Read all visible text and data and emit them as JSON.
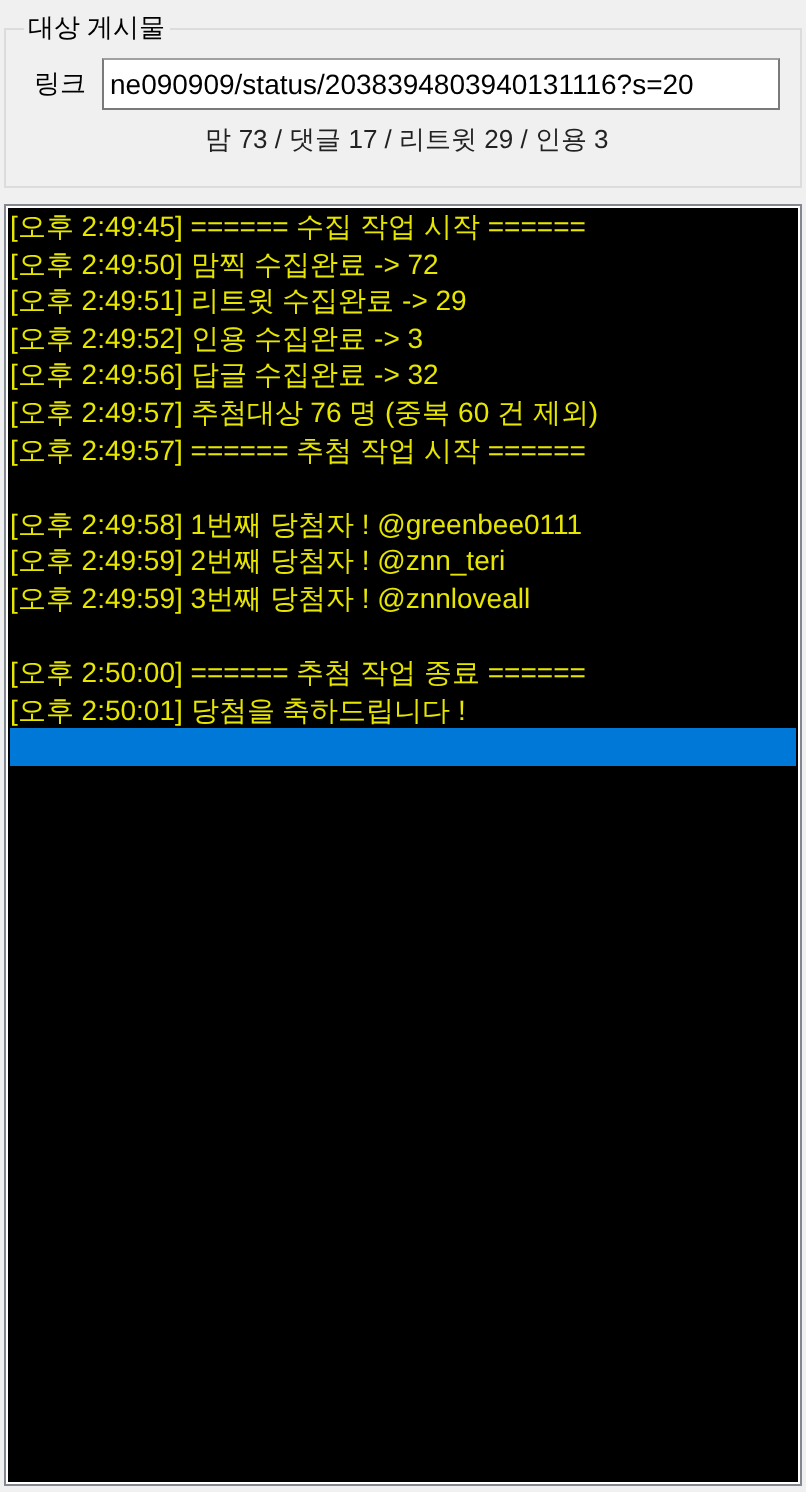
{
  "target_post": {
    "title": "대상 게시물",
    "link_label": "링크",
    "link_value": "ne090909/status/2038394803940131116?s=20",
    "stats": "맘 73 / 댓글 17 / 리트윗 29 / 인용 3"
  },
  "log": [
    {
      "kind": "text",
      "text": "[오후 2:49:45] ====== 수집 작업 시작 ======",
      "selected": false
    },
    {
      "kind": "text",
      "text": "[오후 2:49:50] 맘찍 수집완료 -> 72",
      "selected": false
    },
    {
      "kind": "text",
      "text": "[오후 2:49:51] 리트윗 수집완료 -> 29",
      "selected": false
    },
    {
      "kind": "text",
      "text": "[오후 2:49:52] 인용 수집완료 -> 3",
      "selected": false
    },
    {
      "kind": "text",
      "text": "[오후 2:49:56] 답글 수집완료 -> 32",
      "selected": false
    },
    {
      "kind": "text",
      "text": "[오후 2:49:57] 추첨대상 76 명 (중복 60 건 제외)",
      "selected": false
    },
    {
      "kind": "text",
      "text": "[오후 2:49:57] ====== 추첨 작업 시작 ======",
      "selected": false
    },
    {
      "kind": "blank",
      "selected": false
    },
    {
      "kind": "text",
      "text": "[오후 2:49:58] 1번째 당첨자 ! @greenbee0111",
      "selected": false
    },
    {
      "kind": "text",
      "text": "[오후 2:49:59] 2번째 당첨자 ! @znn_teri",
      "selected": false
    },
    {
      "kind": "text",
      "text": "[오후 2:49:59] 3번째 당첨자 ! @znnloveall",
      "selected": false
    },
    {
      "kind": "blank",
      "selected": false
    },
    {
      "kind": "text",
      "text": "[오후 2:50:00] ====== 추첨 작업 종료 ======",
      "selected": false
    },
    {
      "kind": "text",
      "text": "[오후 2:50:01] 당첨을 축하드립니다 !",
      "selected": false
    },
    {
      "kind": "blank",
      "selected": true
    }
  ]
}
